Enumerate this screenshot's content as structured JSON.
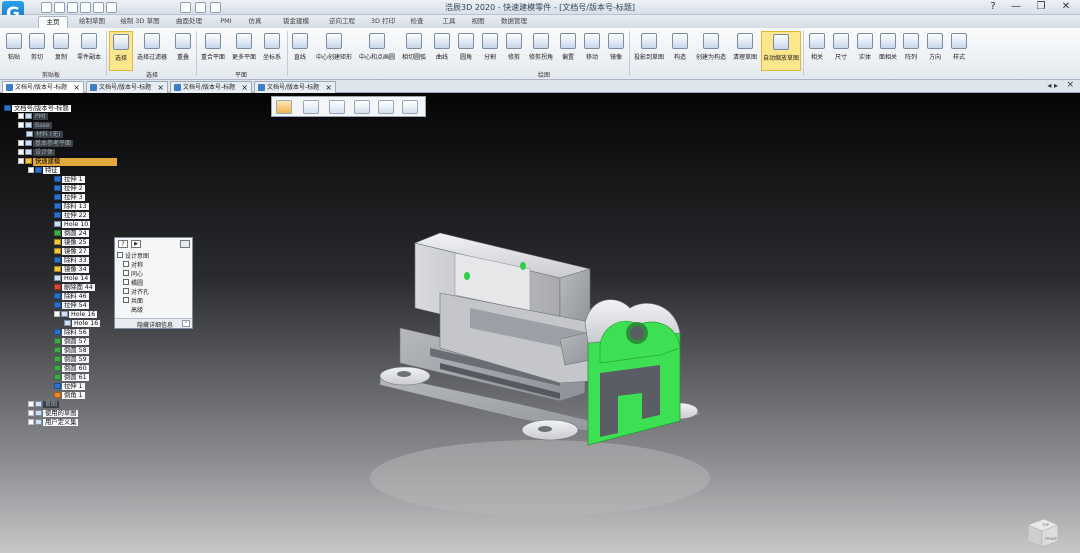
{
  "app": {
    "title": "浩辰3D 2020 - 快速建模零件 - [文档号/版本号-标题]",
    "logo": "G",
    "window_buttons": [
      "?",
      "—",
      "❐",
      "✕"
    ]
  },
  "menu_tabs": [
    "主页",
    "绘制草图",
    "绘制 3D 草图",
    "曲面处理",
    "PMI",
    "仿真",
    "钣金建模",
    "逆向工程",
    "3D 打印",
    "检查",
    "工具",
    "视图",
    "数据管理"
  ],
  "ribbon": {
    "groups": [
      "剪贴板",
      "选择",
      "平面",
      "绘图"
    ],
    "buttons": [
      "粘贴",
      "剪切",
      "复制",
      "零件副本",
      "选择",
      "选择过滤器",
      "重叠",
      "重合平面",
      "更多平面",
      "坐标系",
      "直线",
      "中心创建矩形",
      "中心和点画圆",
      "相切圆弧",
      "曲线",
      "圆角",
      "分割",
      "修剪",
      "修剪拐角",
      "偏置",
      "移动",
      "镜像",
      "投影到草图",
      "构造",
      "创建为构造",
      "清理草图",
      "自动缩放草图",
      "相关",
      "尺寸",
      "实体",
      "面相关",
      "阵列",
      "方向",
      "样式"
    ]
  },
  "doc_tabs": [
    "文档号/版本号-标题",
    "文档号/版本号-标题",
    "文档号/版本号-标题",
    "文档号/版本号-标题"
  ],
  "tree": [
    {
      "text": "文档号/版本号-标题"
    },
    {
      "text": "PMI"
    },
    {
      "text": "Base"
    },
    {
      "text": "材料 (无)"
    },
    {
      "text": "基本参考平面"
    },
    {
      "text": "设计体"
    },
    {
      "text": "快速建模"
    },
    {
      "text": "特征"
    },
    {
      "text": "拉伸 1"
    },
    {
      "text": "拉伸 2"
    },
    {
      "text": "拉伸 3"
    },
    {
      "text": "除料 13"
    },
    {
      "text": "拉伸 22"
    },
    {
      "text": "Hole 10"
    },
    {
      "text": "倒圆 24"
    },
    {
      "text": "镜像 25"
    },
    {
      "text": "镜像 27"
    },
    {
      "text": "除料 33"
    },
    {
      "text": "镜像 34"
    },
    {
      "text": "Hole 14"
    },
    {
      "text": "删除面 44"
    },
    {
      "text": "除料 46"
    },
    {
      "text": "拉伸 54"
    },
    {
      "text": "Hole 16"
    },
    {
      "text": "Hole 16"
    },
    {
      "text": "除料 56"
    },
    {
      "text": "倒圆 57"
    },
    {
      "text": "倒圆 58"
    },
    {
      "text": "倒圆 59"
    },
    {
      "text": "倒圆 60"
    },
    {
      "text": "倒圆 61"
    },
    {
      "text": "拉伸 1"
    },
    {
      "text": "倒角 1"
    },
    {
      "text": "草图"
    },
    {
      "text": "使用的草图"
    },
    {
      "text": "用户定义集"
    }
  ],
  "panel": {
    "help": "?",
    "play": "▶",
    "title": "设计意图",
    "items": [
      "对称",
      "同心",
      "橘圆",
      "对齐孔",
      "共面"
    ],
    "advanced": "高级",
    "footer": "隐藏详细信息"
  },
  "view_cube": {
    "top": "TOP",
    "front": "FRONT"
  }
}
